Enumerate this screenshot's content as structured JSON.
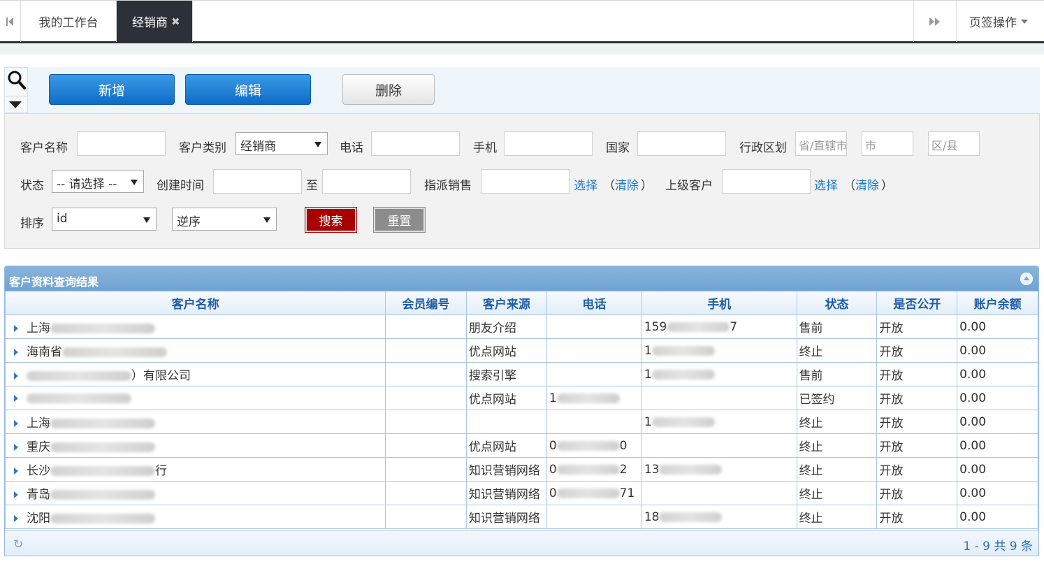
{
  "tabs": {
    "items": [
      {
        "label": "我的工作台",
        "active": false
      },
      {
        "label": "经销商",
        "active": true,
        "close": "✖"
      }
    ],
    "ops_label": "页签操作"
  },
  "toolbar": {
    "add_label": "新增",
    "edit_label": "编辑",
    "delete_label": "删除"
  },
  "form": {
    "customer_name_label": "客户名称",
    "customer_type_label": "客户类别",
    "customer_type_value": "经销商",
    "phone_label": "电话",
    "mobile_label": "手机",
    "country_label": "国家",
    "region_label": "行政区划",
    "province_placeholder": "省/直辖市",
    "city_placeholder": "市",
    "district_placeholder": "区/县",
    "status_label": "状态",
    "status_value": "-- 请选择 --",
    "created_label": "创建时间",
    "to_label": "至",
    "sales_label": "指派销售",
    "select_label": "选择",
    "clear_label": "清除",
    "open_paren": "（",
    "close_paren": "）",
    "parent_label": "上级客户",
    "sort_label": "排序",
    "sort_field_value": "id",
    "sort_order_value": "逆序",
    "search_label": "搜索",
    "reset_label": "重置"
  },
  "grid": {
    "title": "客户资料查询结果",
    "columns": [
      "客户名称",
      "会员编号",
      "客户来源",
      "电话",
      "手机",
      "状态",
      "是否公开",
      "账户余额"
    ],
    "rows": [
      {
        "name_prefix": "上海",
        "name_suffix": "",
        "source": "朋友介绍",
        "phone_prefix": "",
        "phone_suffix": "",
        "mobile_prefix": "159",
        "mobile_suffix": "7",
        "status": "售前",
        "public": "开放",
        "balance": "0.00"
      },
      {
        "name_prefix": "海南省",
        "name_suffix": "",
        "source": "优点网站",
        "phone_prefix": "",
        "phone_suffix": "",
        "mobile_prefix": "1",
        "mobile_suffix": "",
        "status": "终止",
        "public": "开放",
        "balance": "0.00"
      },
      {
        "name_prefix": "",
        "name_suffix": "）有限公司",
        "source": "搜索引擎",
        "phone_prefix": "",
        "phone_suffix": "",
        "mobile_prefix": "1",
        "mobile_suffix": "",
        "status": "售前",
        "public": "开放",
        "balance": "0.00"
      },
      {
        "name_prefix": "",
        "name_suffix": "",
        "source": "优点网站",
        "phone_prefix": "1",
        "phone_suffix": "",
        "mobile_prefix": "",
        "mobile_suffix": "",
        "status": "已签约",
        "public": "开放",
        "balance": "0.00"
      },
      {
        "name_prefix": "上海",
        "name_suffix": "",
        "source": "",
        "phone_prefix": "",
        "phone_suffix": "",
        "mobile_prefix": "1",
        "mobile_suffix": "",
        "status": "终止",
        "public": "开放",
        "balance": "0.00"
      },
      {
        "name_prefix": "重庆",
        "name_suffix": "",
        "source": "优点网站",
        "phone_prefix": "0",
        "phone_suffix": "0",
        "mobile_prefix": "",
        "mobile_suffix": "",
        "status": "终止",
        "public": "开放",
        "balance": "0.00"
      },
      {
        "name_prefix": "长沙",
        "name_suffix": "行",
        "source": "知识营销网络",
        "phone_prefix": "0",
        "phone_suffix": "2",
        "mobile_prefix": "13",
        "mobile_suffix": "",
        "status": "终止",
        "public": "开放",
        "balance": "0.00"
      },
      {
        "name_prefix": "青岛",
        "name_suffix": "",
        "source": "知识营销网络",
        "phone_prefix": "0",
        "phone_suffix": "71",
        "mobile_prefix": "",
        "mobile_suffix": "",
        "status": "终止",
        "public": "开放",
        "balance": "0.00"
      },
      {
        "name_prefix": "沈阳",
        "name_suffix": "",
        "source": "知识营销网络",
        "phone_prefix": "",
        "phone_suffix": "",
        "mobile_prefix": "18",
        "mobile_suffix": "",
        "status": "终止",
        "public": "开放",
        "balance": "0.00"
      }
    ],
    "pager_text": "1 - 9   共 9 条"
  },
  "icons": [
    "first-page-icon",
    "close-icon",
    "next-page-icon",
    "chevron-down-icon",
    "search-icon",
    "expand-icon",
    "row-expand-icon",
    "collapse-icon",
    "refresh-icon"
  ]
}
